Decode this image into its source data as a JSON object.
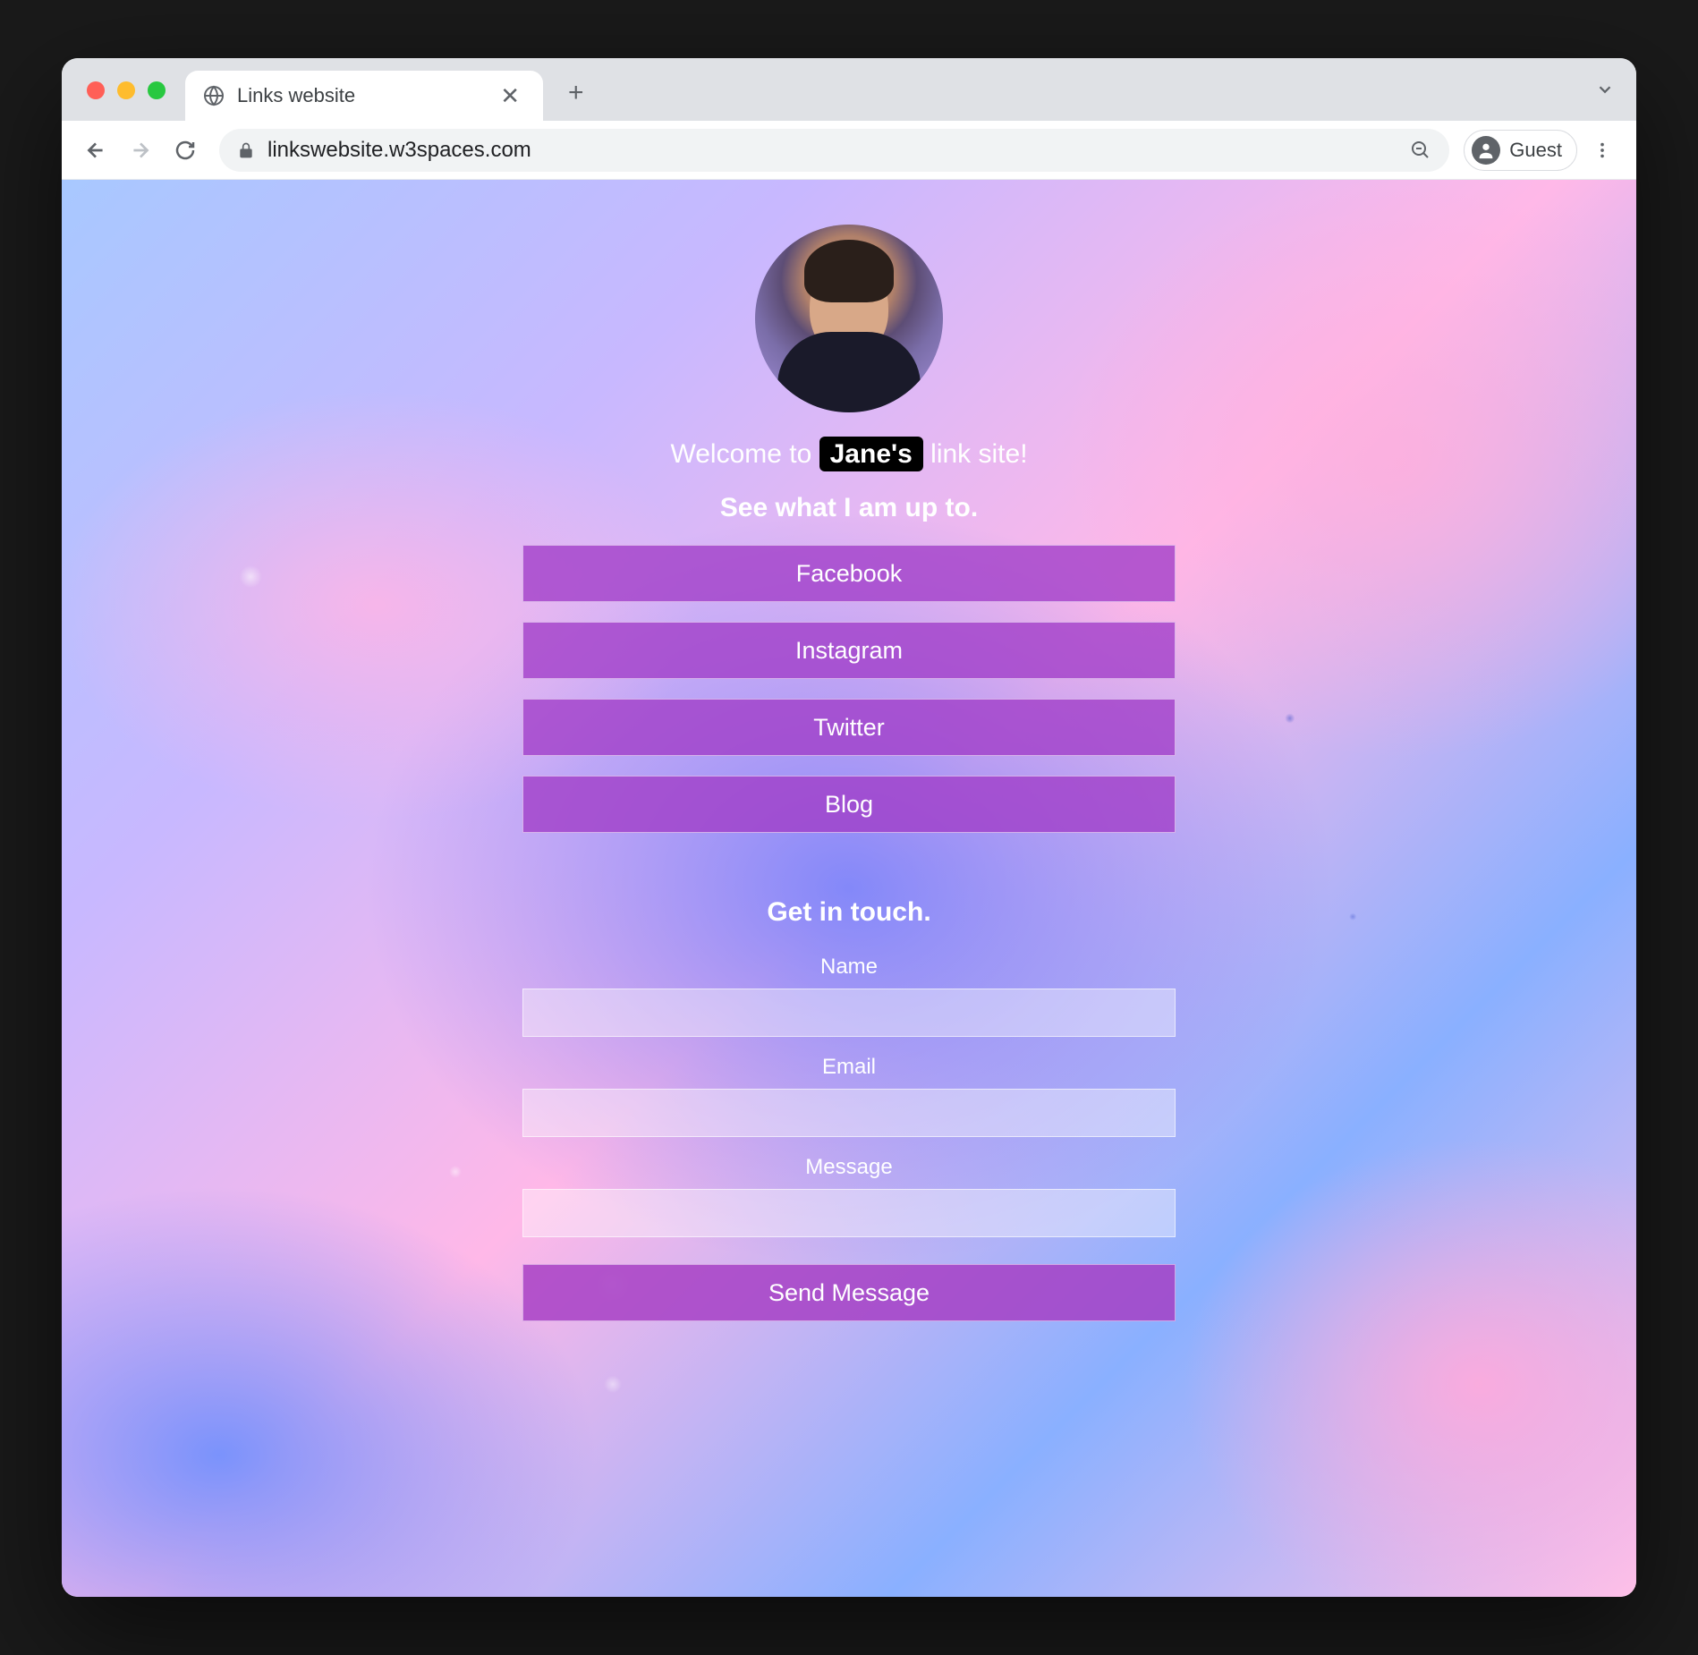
{
  "browser": {
    "tab_title": "Links website",
    "url": "linkswebsite.w3spaces.com",
    "guest_label": "Guest"
  },
  "page": {
    "welcome_prefix": "Welcome to ",
    "welcome_name": "Jane's",
    "welcome_suffix": " link site!",
    "subheading": "See what I am up to.",
    "links": [
      {
        "label": "Facebook"
      },
      {
        "label": "Instagram"
      },
      {
        "label": "Twitter"
      },
      {
        "label": "Blog"
      }
    ],
    "contact": {
      "heading": "Get in touch.",
      "fields": [
        {
          "label": "Name"
        },
        {
          "label": "Email"
        },
        {
          "label": "Message"
        }
      ],
      "submit_label": "Send Message"
    }
  }
}
